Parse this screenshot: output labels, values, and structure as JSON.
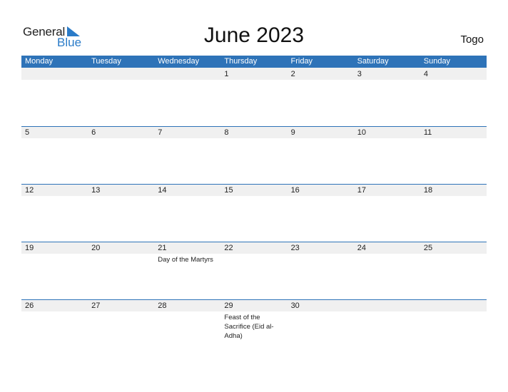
{
  "logo": {
    "word1": "General",
    "word2": "Blue"
  },
  "title": "June 2023",
  "country": "Togo",
  "colors": {
    "accent": "#2e73b8",
    "strip": "#f0f0f0",
    "logo_blue": "#2a7bc8"
  },
  "weekdays": [
    "Monday",
    "Tuesday",
    "Wednesday",
    "Thursday",
    "Friday",
    "Saturday",
    "Sunday"
  ],
  "weeks": [
    {
      "days": [
        {
          "n": ""
        },
        {
          "n": ""
        },
        {
          "n": ""
        },
        {
          "n": "1"
        },
        {
          "n": "2"
        },
        {
          "n": "3"
        },
        {
          "n": "4"
        }
      ]
    },
    {
      "days": [
        {
          "n": "5"
        },
        {
          "n": "6"
        },
        {
          "n": "7"
        },
        {
          "n": "8"
        },
        {
          "n": "9"
        },
        {
          "n": "10"
        },
        {
          "n": "11"
        }
      ]
    },
    {
      "days": [
        {
          "n": "12"
        },
        {
          "n": "13"
        },
        {
          "n": "14"
        },
        {
          "n": "15"
        },
        {
          "n": "16"
        },
        {
          "n": "17"
        },
        {
          "n": "18"
        }
      ]
    },
    {
      "days": [
        {
          "n": "19"
        },
        {
          "n": "20"
        },
        {
          "n": "21",
          "event": "Day of the Martyrs"
        },
        {
          "n": "22"
        },
        {
          "n": "23"
        },
        {
          "n": "24"
        },
        {
          "n": "25"
        }
      ]
    },
    {
      "days": [
        {
          "n": "26"
        },
        {
          "n": "27"
        },
        {
          "n": "28"
        },
        {
          "n": "29",
          "event": "Feast of the Sacrifice (Eid al-Adha)"
        },
        {
          "n": "30"
        },
        {
          "n": ""
        },
        {
          "n": ""
        }
      ]
    }
  ]
}
